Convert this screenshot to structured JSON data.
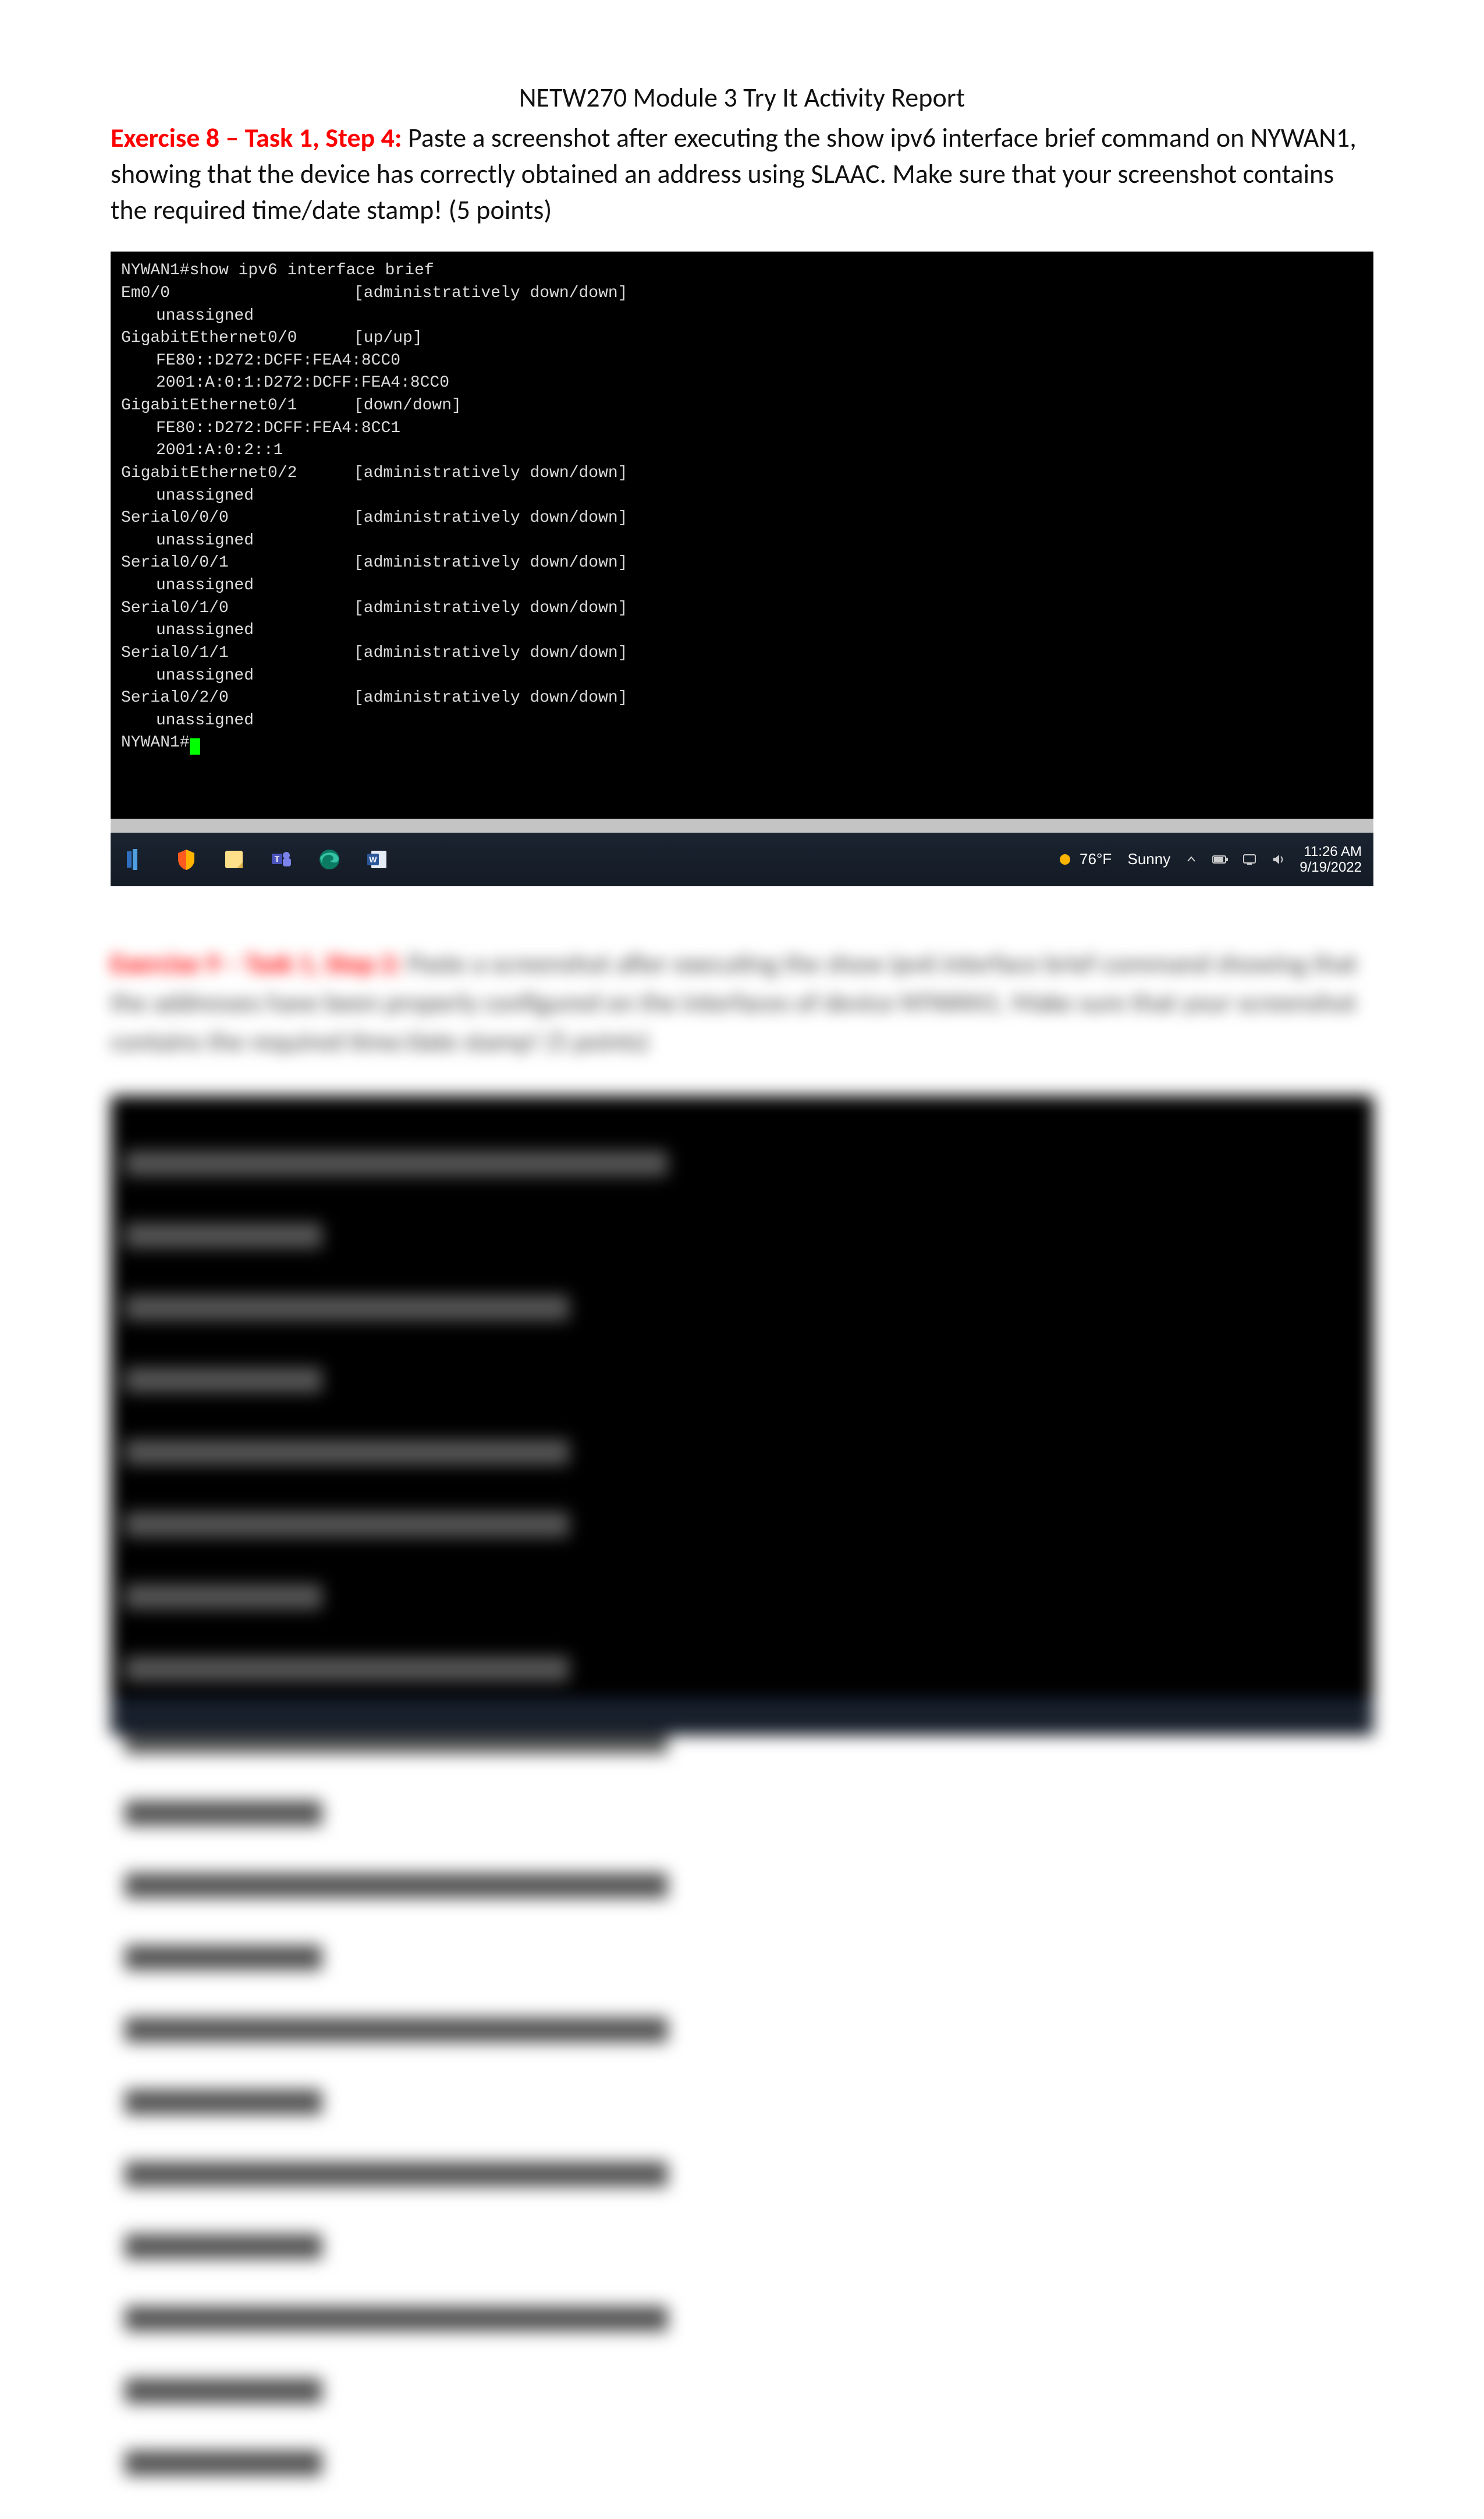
{
  "doc_title": "NETW270 Module 3 Try It Activity Report",
  "ex8": {
    "label": "Exercise 8 – Task 1, Step 4:",
    "text": " Paste a screenshot after executing the show ipv6 interface brief command on NYWAN1, showing that the device has correctly obtained an address using SLAAC. Make sure that your screenshot contains the required time/date stamp!  (5 points)"
  },
  "terminal": {
    "cmd": "NYWAN1#show ipv6 interface brief",
    "rows": [
      {
        "if": "Em0/0",
        "st": "[administratively down/down]",
        "addrs": [
          "unassigned"
        ]
      },
      {
        "if": "GigabitEthernet0/0",
        "st": "[up/up]",
        "addrs": [
          "FE80::D272:DCFF:FEA4:8CC0",
          "2001:A:0:1:D272:DCFF:FEA4:8CC0"
        ]
      },
      {
        "if": "GigabitEthernet0/1",
        "st": "[down/down]",
        "addrs": [
          "FE80::D272:DCFF:FEA4:8CC1",
          "2001:A:0:2::1"
        ]
      },
      {
        "if": "GigabitEthernet0/2",
        "st": "[administratively down/down]",
        "addrs": [
          "unassigned"
        ]
      },
      {
        "if": "Serial0/0/0",
        "st": "[administratively down/down]",
        "addrs": [
          "unassigned"
        ]
      },
      {
        "if": "Serial0/0/1",
        "st": "[administratively down/down]",
        "addrs": [
          "unassigned"
        ]
      },
      {
        "if": "Serial0/1/0",
        "st": "[administratively down/down]",
        "addrs": [
          "unassigned"
        ]
      },
      {
        "if": "Serial0/1/1",
        "st": "[administratively down/down]",
        "addrs": [
          "unassigned"
        ]
      },
      {
        "if": "Serial0/2/0",
        "st": "[administratively down/down]",
        "addrs": [
          "unassigned"
        ]
      }
    ],
    "prompt": "NYWAN1#"
  },
  "taskbar": {
    "weather_temp": "76°F",
    "weather_cond": "Sunny",
    "time": "11:26 AM",
    "date": "9/19/2022"
  },
  "ex9_blurred": {
    "label": "Exercise 9 – Task 1, Step 2:",
    "text": " Paste a screenshot after executing the show ipv6 interface brief command showing that the addresses have been properly configured on the interfaces of device NYWAN1. Make sure that your screenshot contains the required time/date stamp!  (5 points)"
  }
}
